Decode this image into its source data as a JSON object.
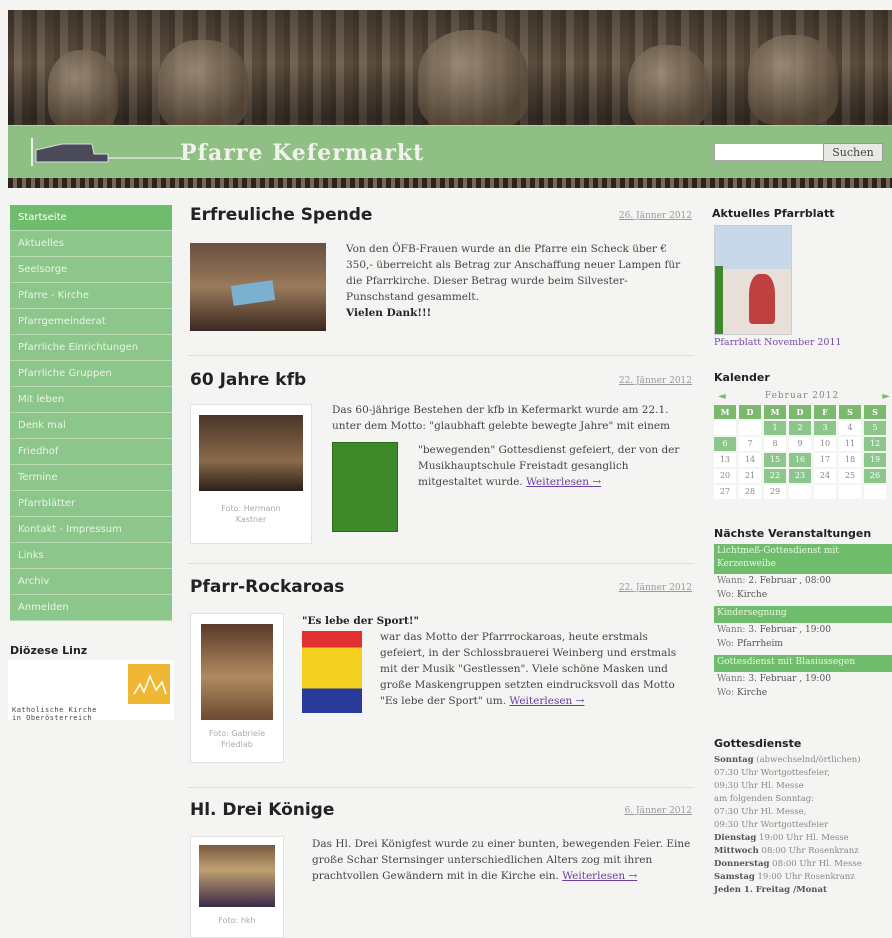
{
  "header": {
    "site_title": "Pfarre Kefermarkt",
    "search_placeholder": "",
    "search_button": "Suchen"
  },
  "nav": {
    "items": [
      "Startseite",
      "Aktuelles",
      "Seelsorge",
      "Pfarre - Kirche",
      "Pfarrgemeinderat",
      "Pfarrliche Einrichtungen",
      "Pfarrliche Gruppen",
      "Mit leben",
      "Denk mal",
      "Friedhof",
      "Termine",
      "Pfarrblätter",
      "Kontakt - Impressum",
      "Links",
      "Archiv",
      "Anmelden"
    ]
  },
  "dioezese": {
    "title": "Diözese Linz",
    "logo_text_1": "Katholische Kirche",
    "logo_text_2": "in Oberösterreich"
  },
  "articles": [
    {
      "title": "Erfreuliche Spende",
      "date": "26. Jänner 2012",
      "text": "Von den ÖFB-Frauen wurde an die Pfarre ein Scheck über € 350,- überreicht als Betrag zur Anschaffung neuer Lampen für die Pfarrkirche. Dieser Betrag wurde beim Silvester-Punschstand gesammelt.",
      "emphasis": "Vielen Dank!!!"
    },
    {
      "title": "60 Jahre kfb",
      "date": "22. Jänner 2012",
      "text_top": "Das 60-jährige Bestehen der kfb in Kefermarkt wurde am 22.1. unter dem Motto: \"glaubhaft gelebte bewegte Jahre\" mit einem",
      "text_side": "\"bewegenden\" Gottesdienst gefeiert, der von der Musikhauptschule Freistadt gesanglich mitgestaltet wurde.",
      "more": "Weiterlesen →",
      "caption_1": "Foto: Hermann",
      "caption_2": "Kastner"
    },
    {
      "title": "Pfarr-Rockaroas",
      "date": "22. Jänner 2012",
      "quote": "\"Es lebe der Sport!\"",
      "text": "war das Motto der Pfarrrockaroas, heute erstmals gefeiert, in der Schlossbrauerei Weinberg und erstmals mit der Musik \"Gestlessen\". Viele schöne Masken und große Maskengruppen setzten eindrucksvoll das Motto \"Es lebe der Sport\" um.",
      "more": "Weiterlesen →",
      "caption_1": "Foto: Gabriele",
      "caption_2": "Friedlab"
    },
    {
      "title": "Hl. Drei Könige",
      "date": "6. Jänner 2012",
      "text": "Das Hl. Drei Königfest wurde zu einer bunten, bewegenden Feier. Eine große Schar Sternsinger unterschiedlichen Alters zog mit ihren prachtvollen Gewändern mit in die Kirche ein.",
      "more": "Weiterlesen →",
      "caption_1": "Foto: hkh"
    }
  ],
  "right": {
    "pfarrblatt_title": "Aktuelles Pfarrblatt",
    "pfarrblatt_link": "Pfarrblatt November 2011",
    "calendar_title": "Kalender",
    "calendar_month": "Februar 2012",
    "calendar_days": [
      "M",
      "D",
      "M",
      "D",
      "F",
      "S",
      "S"
    ],
    "calendar_rows": [
      [
        "",
        "",
        "1",
        "2",
        "3",
        "4",
        "5"
      ],
      [
        "6",
        "7",
        "8",
        "9",
        "10",
        "11",
        "12"
      ],
      [
        "13",
        "14",
        "15",
        "16",
        "17",
        "18",
        "19"
      ],
      [
        "20",
        "21",
        "22",
        "23",
        "24",
        "25",
        "26"
      ],
      [
        "27",
        "28",
        "29",
        "",
        "",
        "",
        ""
      ]
    ],
    "events_title": "Nächste Veranstaltungen",
    "events": [
      {
        "title": "Lichtmeß-Gottesdienst mit Kerzenweihe",
        "wann_label": "Wann:",
        "wann": "2. Februar , 08:00",
        "wo_label": "Wo:",
        "wo": "Kirche"
      },
      {
        "title": "Kindersegnung",
        "wann_label": "Wann:",
        "wann": "3. Februar , 19:00",
        "wo_label": "Wo:",
        "wo": "Pfarrheim"
      },
      {
        "title": "Gottesdienst mit Blasiussegen",
        "wann_label": "Wann:",
        "wann": "3. Februar , 19:00",
        "wo_label": "Wo:",
        "wo": "Kirche"
      }
    ],
    "gottesdienste_title": "Gottesdienste",
    "gottesdienste": [
      {
        "b": "Sonntag",
        "t": " (abwechselnd/örtlichen)"
      },
      {
        "b": "",
        "t": "07:30 Uhr Wortgottesfeier,"
      },
      {
        "b": "",
        "t": "09:30 Uhr Hl. Messe"
      },
      {
        "b": "",
        "t": "am folgenden Sonntag:"
      },
      {
        "b": "",
        "t": "07:30 Uhr Hl. Messe,"
      },
      {
        "b": "",
        "t": "09:30 Uhr Wortgottesfeier"
      },
      {
        "b": "Dienstag",
        "t": " 19:00 Uhr Hl. Messe"
      },
      {
        "b": "Mittwoch",
        "t": " 08:00 Uhr Rosenkranz"
      },
      {
        "b": "Donnerstag",
        "t": " 08:00 Uhr Hl. Messe"
      },
      {
        "b": "Samstag",
        "t": " 19:00 Uhr Rosenkranz"
      },
      {
        "b": "Jeden 1. Freitag /Monat",
        "t": ""
      }
    ]
  },
  "colors": {
    "nav_green": "#8cc68a",
    "header_band": "#8fbf85",
    "event_green": "#6fbd6c"
  }
}
